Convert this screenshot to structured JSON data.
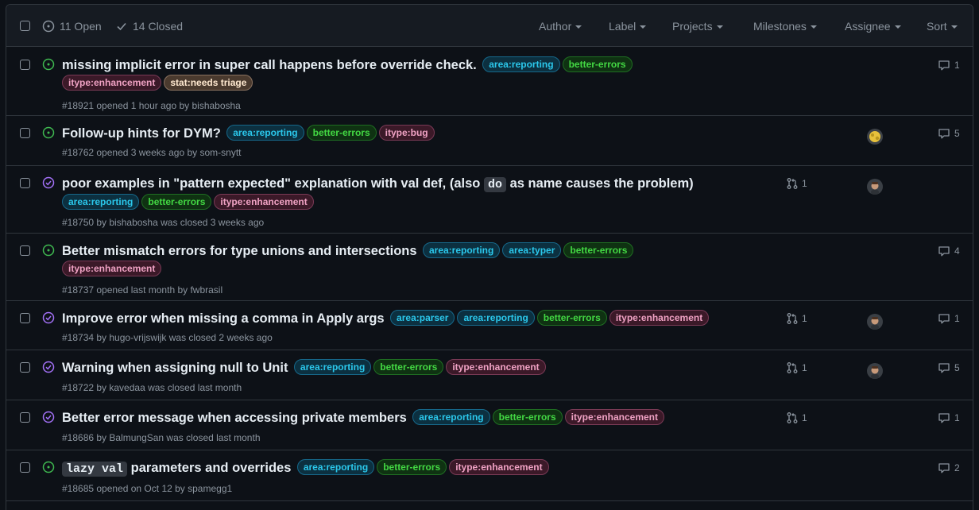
{
  "header": {
    "open_label": "11 Open",
    "closed_label": "14 Closed",
    "filters": {
      "author": "Author",
      "label": "Label",
      "projects": "Projects",
      "milestones": "Milestones",
      "assignee": "Assignee",
      "sort": "Sort"
    }
  },
  "colors": {
    "open": "#3fb950",
    "closed": "#a371f7",
    "label_area": "#2bc8ec",
    "label_better_errors": "#43d843",
    "label_enhancement": "#f0a2c4"
  },
  "issues": [
    {
      "state": "open",
      "title": "missing implicit error in super call happens before override check.",
      "labels": [
        "area:reporting",
        "better-errors",
        "itype:enhancement",
        "stat:needs triage"
      ],
      "meta": "#18921 opened 1 hour ago by bishabosha",
      "comments": "1"
    },
    {
      "state": "open",
      "title": "Follow-up hints for DYM?",
      "labels": [
        "area:reporting",
        "better-errors",
        "itype:bug"
      ],
      "meta": "#18762 opened 3 weeks ago by som-snytt",
      "comments": "5",
      "avatar": "yellow-avatar"
    },
    {
      "state": "closed",
      "title_pre": "poor examples in \"pattern expected\" explanation with val def, (also",
      "title_code": "do",
      "title_post": "as name causes the problem)",
      "labels": [
        "area:reporting",
        "better-errors",
        "itype:enhancement"
      ],
      "meta": "#18750 by bishabosha was closed 3 weeks ago",
      "prs": "1",
      "avatar": "person-avatar"
    },
    {
      "state": "open",
      "title": "Better mismatch errors for type unions and intersections",
      "labels": [
        "area:reporting",
        "area:typer",
        "better-errors",
        "itype:enhancement"
      ],
      "meta": "#18737 opened last month by fwbrasil",
      "comments": "4"
    },
    {
      "state": "closed",
      "title": "Improve error when missing a comma in Apply args",
      "labels": [
        "area:parser",
        "area:reporting",
        "better-errors",
        "itype:enhancement"
      ],
      "meta": "#18734 by hugo-vrijswijk was closed 2 weeks ago",
      "prs": "1",
      "comments": "1",
      "avatar": "person-avatar"
    },
    {
      "state": "closed",
      "title": "Warning when assigning null to Unit",
      "labels": [
        "area:reporting",
        "better-errors",
        "itype:enhancement"
      ],
      "meta": "#18722 by kavedaa was closed last month",
      "prs": "1",
      "comments": "5",
      "avatar": "person-avatar"
    },
    {
      "state": "closed",
      "title": "Better error message when accessing private members",
      "labels": [
        "area:reporting",
        "better-errors",
        "itype:enhancement"
      ],
      "meta": "#18686 by BalmungSan was closed last month",
      "prs": "1",
      "comments": "1"
    },
    {
      "state": "open",
      "title_code": "lazy val",
      "title_post": "parameters and overrides",
      "labels": [
        "area:reporting",
        "better-errors",
        "itype:enhancement"
      ],
      "meta": "#18685 opened on Oct 12 by spamegg1",
      "comments": "2"
    }
  ]
}
